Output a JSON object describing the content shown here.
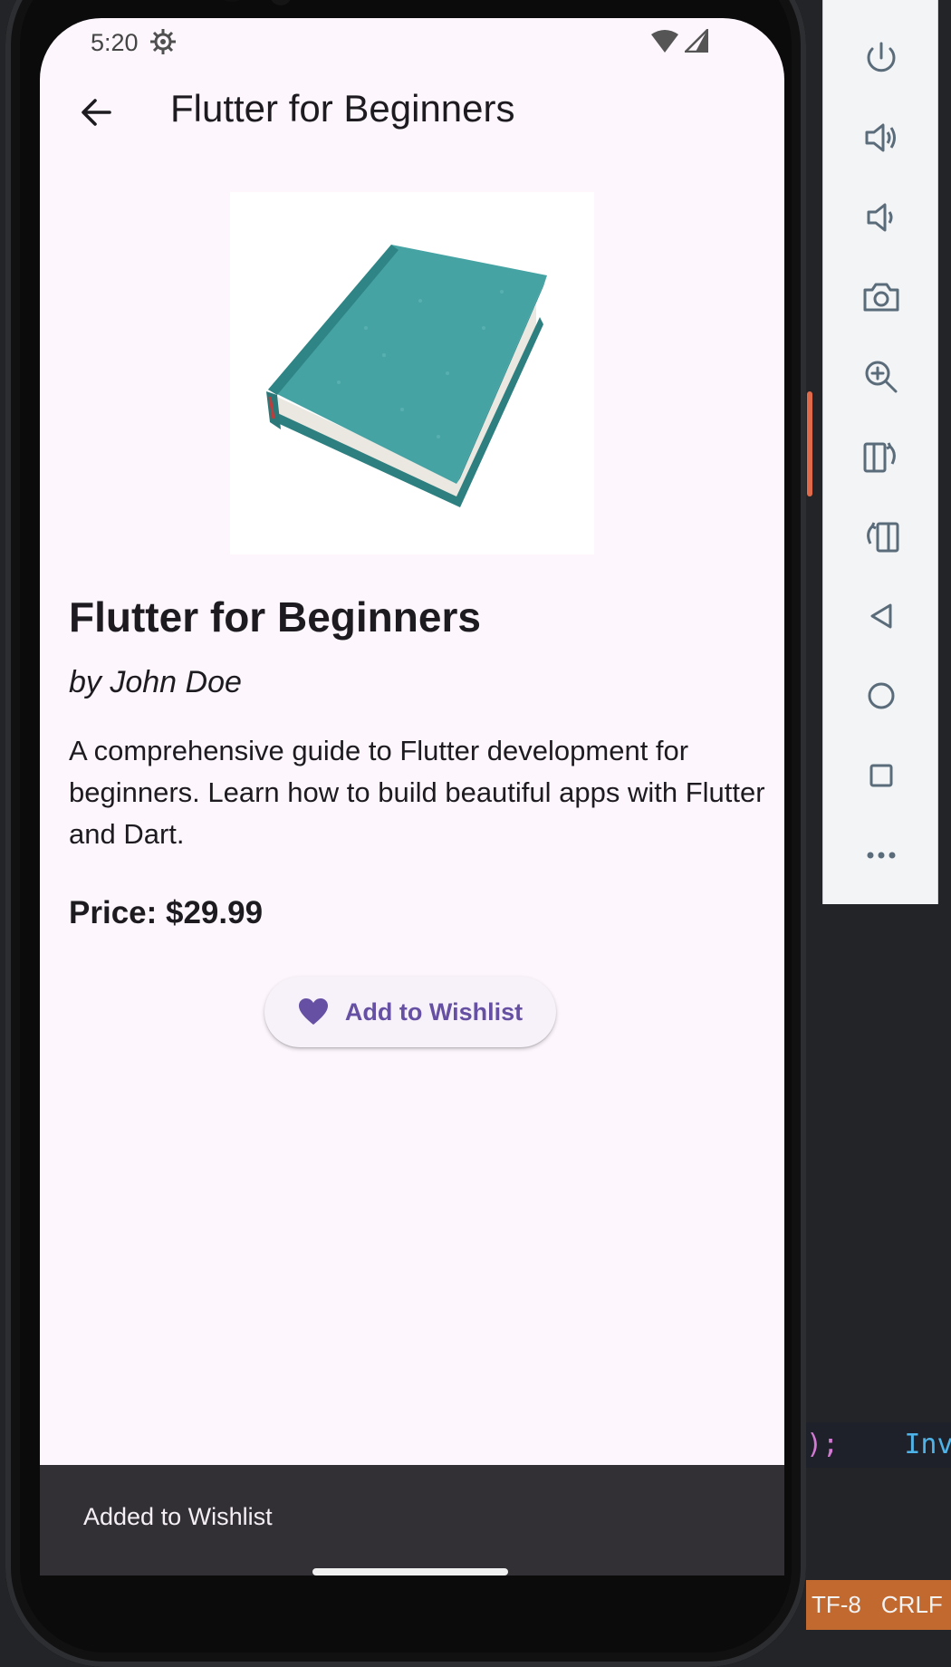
{
  "status_bar": {
    "time": "5:20",
    "gear_icon": "settings-gear-icon",
    "wifi_icon": "wifi-icon",
    "signal_icon": "cell-signal-icon"
  },
  "app_bar": {
    "back_icon": "arrow-back-icon",
    "title": "Flutter for Beginners"
  },
  "book": {
    "cover_image": "book-cover-image",
    "title": "Flutter for Beginners",
    "author": "by John Doe",
    "description": "A comprehensive guide to Flutter development for beginners. Learn how to build beautiful apps with Flutter and Dart.",
    "price": "Price: $29.99"
  },
  "wishlist_button": {
    "label": "Add to Wishlist",
    "icon": "heart-icon"
  },
  "snackbar": {
    "message": "Added to Wishlist"
  },
  "emulator_toolbar": {
    "buttons": [
      "power-icon",
      "volume-up-icon",
      "volume-down-icon",
      "camera-icon",
      "zoom-in-icon",
      "rotate-left-icon",
      "rotate-right-icon",
      "back-triangle-icon",
      "home-circle-icon",
      "overview-square-icon",
      "more-icon"
    ]
  },
  "ide": {
    "code_paren": ");",
    "code_keyword": "Inv",
    "encoding": "TF-8",
    "line_ending": "CRLF"
  },
  "colors": {
    "screen_background": "#fdf7fd",
    "accent_purple": "#6650a4",
    "snackbar_background": "#322f35",
    "book_teal": "#3f9c9c"
  }
}
